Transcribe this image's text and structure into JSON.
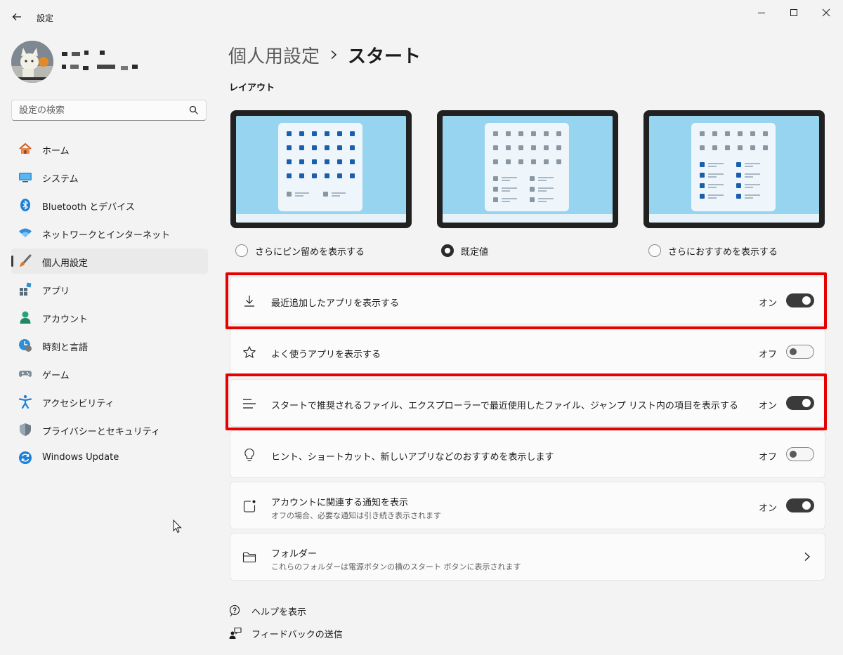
{
  "window": {
    "title": "設定"
  },
  "sidebar": {
    "search_placeholder": "設定の検索",
    "items": [
      {
        "label": "ホーム",
        "icon": "home-icon"
      },
      {
        "label": "システム",
        "icon": "monitor-icon"
      },
      {
        "label": "Bluetooth とデバイス",
        "icon": "bluetooth-icon"
      },
      {
        "label": "ネットワークとインターネット",
        "icon": "wifi-icon"
      },
      {
        "label": "個人用設定",
        "icon": "paintbrush-icon",
        "active": true
      },
      {
        "label": "アプリ",
        "icon": "apps-icon"
      },
      {
        "label": "アカウント",
        "icon": "person-icon"
      },
      {
        "label": "時刻と言語",
        "icon": "clock-globe-icon"
      },
      {
        "label": "ゲーム",
        "icon": "gamepad-icon"
      },
      {
        "label": "アクセシビリティ",
        "icon": "accessibility-icon"
      },
      {
        "label": "プライバシーとセキュリティ",
        "icon": "shield-icon"
      },
      {
        "label": "Windows Update",
        "icon": "sync-icon"
      }
    ]
  },
  "header": {
    "parent": "個人用設定",
    "current": "スタート"
  },
  "layout": {
    "title": "レイアウト",
    "options": [
      {
        "label": "さらにピン留めを表示する",
        "selected": false
      },
      {
        "label": "既定値",
        "selected": true
      },
      {
        "label": "さらにおすすめを表示する",
        "selected": false
      }
    ]
  },
  "settings": [
    {
      "label": "最近追加したアプリを表示する",
      "state": "オン",
      "on": true,
      "icon": "download-icon",
      "highlighted": true
    },
    {
      "label": "よく使うアプリを表示する",
      "state": "オフ",
      "on": false,
      "icon": "star-icon"
    },
    {
      "label": "スタートで推奨されるファイル、エクスプローラーで最近使用したファイル、ジャンプ リスト内の項目を表示する",
      "state": "オン",
      "on": true,
      "icon": "list-lines-icon",
      "highlighted": true
    },
    {
      "label": "ヒント、ショートカット、新しいアプリなどのおすすめを表示します",
      "state": "オフ",
      "on": false,
      "icon": "lightbulb-icon"
    },
    {
      "label": "アカウントに関連する通知を表示",
      "sublabel": "オフの場合、必要な通知は引き続き表示されます",
      "state": "オン",
      "on": true,
      "icon": "notification-badge-icon"
    }
  ],
  "folders": {
    "label": "フォルダー",
    "sublabel": "これらのフォルダーは電源ボタンの横のスタート ボタンに表示されます",
    "icon": "folder-icon"
  },
  "footer": {
    "help": "ヘルプを表示",
    "feedback": "フィードバックの送信"
  },
  "colors": {
    "highlight": "#e60000",
    "toggle_on": "#3a3a3a",
    "accent_blue": "#0067c0"
  }
}
